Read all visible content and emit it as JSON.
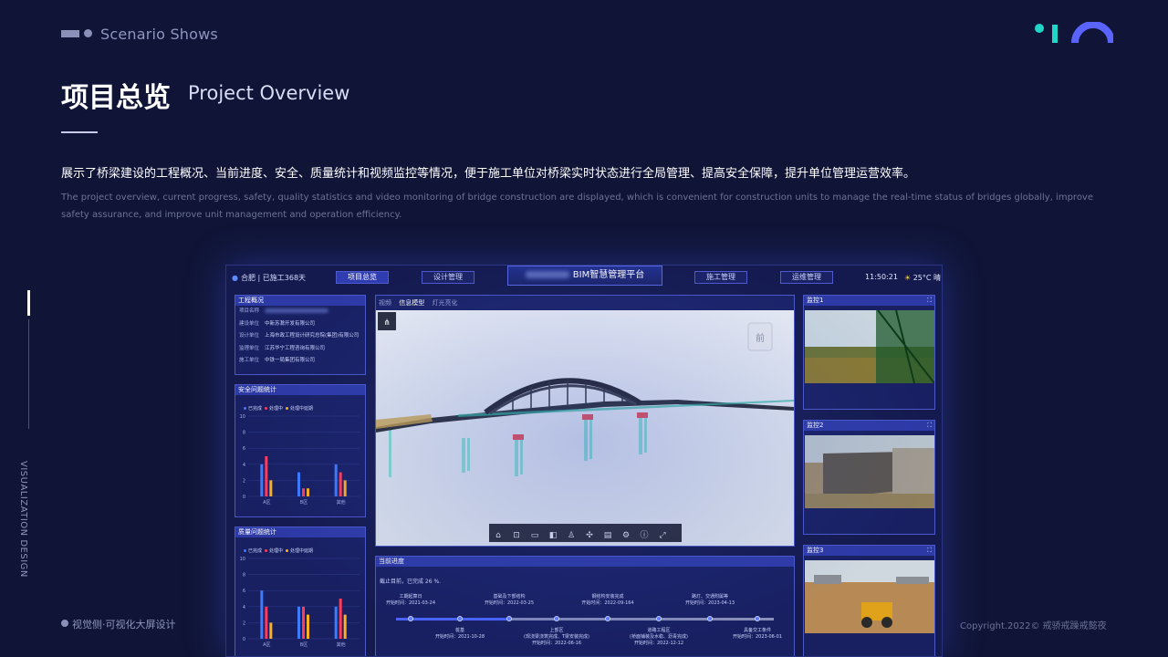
{
  "header": {
    "scenario": "Scenario Shows",
    "title_cn": "项目总览",
    "title_en": "Project Overview",
    "desc_cn": "展示了桥梁建设的工程概况、当前进度、安全、质量统计和视频监控等情况，便于施工单位对桥梁实时状态进行全局管理、提高安全保障，提升单位管理运营效率。",
    "desc_en": "The project overview, current progress, safety, quality statistics and video monitoring of bridge construction are displayed, which is convenient for construction units to manage the real-time status of bridges globally, improve safety assurance, and improve unit management and operation efficiency."
  },
  "side_label": "VISUALIZATION DESIGN",
  "footer": {
    "left": "视觉侧·可视化大屏设计",
    "right": "Copyright.2022© 戒骄戒躁戒懿夜"
  },
  "dashboard": {
    "location": "合肥",
    "built_days": "已施工368天",
    "nav": [
      "项目总览",
      "设计管理",
      "施工管理",
      "运维管理"
    ],
    "platform_title": "BIM智慧管理平台",
    "time": "11:50:21",
    "weather": "25°C 晴",
    "overview": {
      "title": "工程概况",
      "rows": [
        {
          "k": "项目名称",
          "v": ""
        },
        {
          "k": "建设单位",
          "v": "中新苏滁开发有限公司"
        },
        {
          "k": "设计单位",
          "v": "上海市政工程设计研究总院(集团)有限公司"
        },
        {
          "k": "监理单位",
          "v": "江苏华宁工程咨询有限公司"
        },
        {
          "k": "施工单位",
          "v": "中铁一局集团有限公司"
        }
      ]
    },
    "legend": [
      "已完成",
      "处理中",
      "处理中延期"
    ],
    "series_colors": [
      "#3d7bff",
      "#ff3b5c",
      "#ffb020"
    ],
    "model_tabs": [
      "视频",
      "信息模型",
      "灯光亮化"
    ],
    "view_cube": "前",
    "progress": {
      "title": "当前进度",
      "text": "截止目前，已完成 26 %.",
      "top": [
        {
          "label": "工期起算日",
          "date": "开始时间：2021-03-24"
        },
        {
          "label": "基础及下部结构",
          "date": "开始时间：2022-03-25"
        },
        {
          "label": "钢结构安装完成",
          "date": "开始时间：2022-09-164"
        },
        {
          "label": "路灯、交通附属等",
          "date": "开始时间：2023-04-13"
        }
      ],
      "bottom": [
        {
          "label": "桩基",
          "date": "开始时间：2021-10-28"
        },
        {
          "label": "上部区\n(现浇梁浇筑完成、T梁安装完成)",
          "date": "开始时间：2022-06-16"
        },
        {
          "label": "道路工程区\n(桥面铺装及水稳、沥青完成)",
          "date": "开始时间：2022-12-12"
        },
        {
          "label": "具备交工条件",
          "date": "开始时间：2023-06-01"
        }
      ]
    },
    "cameras": [
      "监控1",
      "监控2",
      "监控3"
    ]
  },
  "chart_data": [
    {
      "type": "bar",
      "title": "安全问题统计",
      "categories": [
        "A区",
        "B区",
        "其他"
      ],
      "ylim": [
        0,
        10
      ],
      "yticks": [
        0,
        2,
        4,
        6,
        8,
        10
      ],
      "series": [
        {
          "name": "已完成",
          "values": [
            4,
            3,
            4
          ]
        },
        {
          "name": "处理中",
          "values": [
            5,
            1,
            3
          ]
        },
        {
          "name": "处理中延期",
          "values": [
            2,
            1,
            2
          ]
        }
      ]
    },
    {
      "type": "bar",
      "title": "质量问题统计",
      "categories": [
        "A区",
        "B区",
        "其他"
      ],
      "ylim": [
        0,
        10
      ],
      "yticks": [
        0,
        2,
        4,
        6,
        8,
        10
      ],
      "series": [
        {
          "name": "已完成",
          "values": [
            6,
            4,
            4
          ]
        },
        {
          "name": "处理中",
          "values": [
            4,
            4,
            5
          ]
        },
        {
          "name": "处理中延期",
          "values": [
            2,
            3,
            3
          ]
        }
      ]
    }
  ]
}
